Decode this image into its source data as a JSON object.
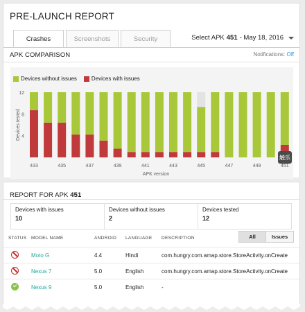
{
  "header": {
    "title": "PRE-LAUNCH REPORT",
    "tabs": [
      {
        "label": "Crashes",
        "active": true
      },
      {
        "label": "Screenshots",
        "active": false
      },
      {
        "label": "Security",
        "active": false
      }
    ],
    "apk_select_prefix": "Select APK",
    "apk_select_value": "451",
    "apk_select_date": "- May 18, 2016"
  },
  "comparison": {
    "heading": "APK COMPARISON",
    "notifications_label": "Notifications:",
    "notifications_value": "Off",
    "legend": [
      {
        "label": "Devices without issues",
        "color": "#a8c83a"
      },
      {
        "label": "Devices with issues",
        "color": "#c0393b"
      }
    ]
  },
  "chart_data": {
    "type": "bar",
    "stacked": true,
    "xlabel": "APK version",
    "ylabel": "Devices tested",
    "ylim": [
      0,
      12
    ],
    "yticks": [
      4,
      8,
      12
    ],
    "y_tick_labels": [
      "4",
      "8",
      "12"
    ],
    "categories": [
      "433",
      "434",
      "435",
      "436",
      "437",
      "438",
      "439",
      "440",
      "441",
      "442",
      "443",
      "444",
      "445",
      "446",
      "447",
      "448",
      "449",
      "450",
      "451"
    ],
    "x_tick_labels": [
      "433",
      "435",
      "437",
      "439",
      "441",
      "443",
      "445",
      "447",
      "449",
      "451"
    ],
    "series": [
      {
        "name": "Devices with issues",
        "color": "#c0393b",
        "values": [
          8.7,
          6.4,
          6.4,
          4.2,
          4.2,
          3.1,
          1.6,
          1.0,
          1.0,
          1.0,
          1.0,
          1.0,
          1.0,
          1.0,
          0.0,
          0.0,
          0.0,
          0.0,
          2.3
        ]
      },
      {
        "name": "Devices without issues",
        "color": "#a8c83a",
        "values": [
          3.3,
          5.6,
          5.6,
          7.8,
          7.8,
          8.9,
          10.4,
          11.0,
          11.0,
          11.0,
          11.0,
          11.0,
          8.3,
          11.0,
          12.0,
          12.0,
          12.0,
          12.0,
          9.7
        ]
      },
      {
        "name": "",
        "color": "#e3e3e3",
        "values": [
          0,
          0,
          0,
          0,
          0,
          0,
          0,
          0,
          0,
          0,
          0,
          0,
          2.7,
          0,
          0,
          0,
          0,
          0,
          0
        ]
      }
    ],
    "grid": false
  },
  "watermark": {
    "text": "触乐"
  },
  "report": {
    "heading": "REPORT FOR APK",
    "apk": "451",
    "stats": [
      {
        "label": "Devices with issues",
        "value": "10"
      },
      {
        "label": "Devices without issues",
        "value": "2"
      },
      {
        "label": "Devices tested",
        "value": "12"
      }
    ],
    "columns": {
      "status": "STATUS",
      "model": "MODEL NAME",
      "android": "ANDROID",
      "language": "LANGUAGE",
      "description": "DESCRIPTION"
    },
    "filter_all": "All",
    "filter_issues": "Issues",
    "rows": [
      {
        "status": "issue",
        "model": "Moto G",
        "android": "4.4",
        "language": "Hindi",
        "description": "com.hungry.com.amap.store.StoreActivity.onCreate"
      },
      {
        "status": "issue",
        "model": "Nexus 7",
        "android": "5.0",
        "language": "English",
        "description": "com.hungry.com.amap.store.StoreActivity.onCreate"
      },
      {
        "status": "ok",
        "model": "Nexus 9",
        "android": "5.0",
        "language": "English",
        "description": "-"
      }
    ]
  }
}
